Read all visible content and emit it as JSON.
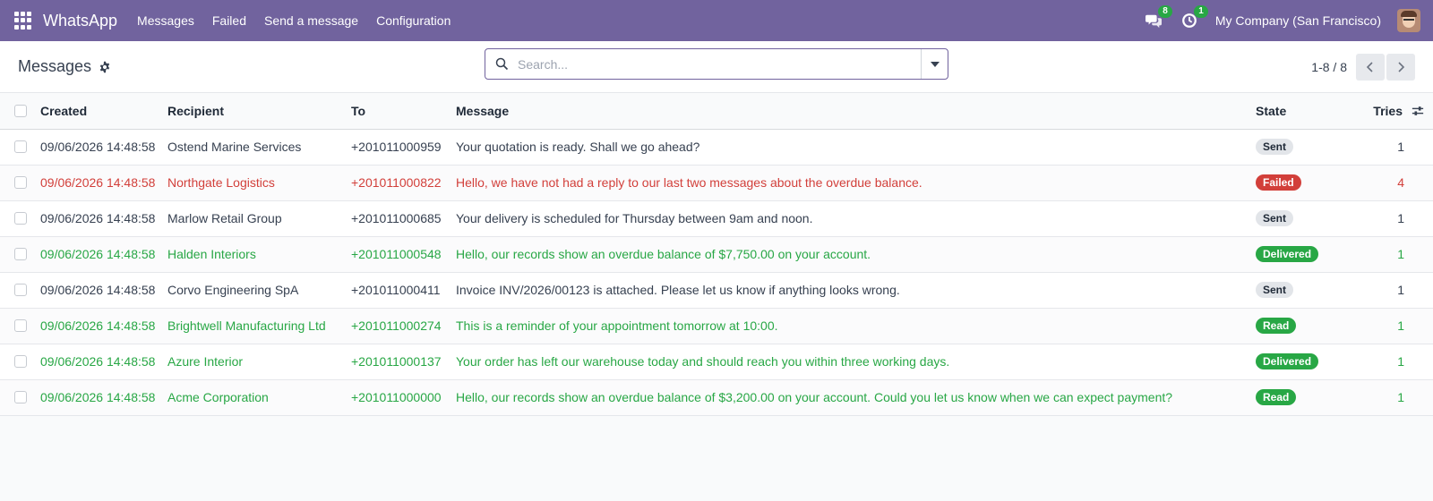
{
  "navbar": {
    "app_name": "WhatsApp",
    "menu": [
      "Messages",
      "Failed",
      "Send a message",
      "Configuration"
    ],
    "messages_count": "8",
    "activities_count": "1",
    "company": "My Company (San Francisco)",
    "color": "#71639e"
  },
  "control_panel": {
    "breadcrumb": "Messages",
    "search_placeholder": "Search...",
    "pager_value": "1-8 / 8"
  },
  "table": {
    "headers": {
      "created": "Created",
      "recipient": "Recipient",
      "to": "To",
      "message": "Message",
      "state": "State",
      "tries": "Tries"
    },
    "rows": [
      {
        "created": "09/06/2026 14:48:58",
        "recipient": "Ostend Marine Services",
        "to": "+201011000959",
        "message": "Your quotation is ready. Shall we go ahead?",
        "state": "Sent",
        "tries": "1",
        "status": "sent"
      },
      {
        "created": "09/06/2026 14:48:58",
        "recipient": "Northgate Logistics",
        "to": "+201011000822",
        "message": "Hello, we have not had a reply to our last two messages about the overdue balance.",
        "state": "Failed",
        "tries": "4",
        "status": "failed"
      },
      {
        "created": "09/06/2026 14:48:58",
        "recipient": "Marlow Retail Group",
        "to": "+201011000685",
        "message": "Your delivery is scheduled for Thursday between 9am and noon.",
        "state": "Sent",
        "tries": "1",
        "status": "sent"
      },
      {
        "created": "09/06/2026 14:48:58",
        "recipient": "Halden Interiors",
        "to": "+201011000548",
        "message": "Hello, our records show an overdue balance of $7,750.00 on your account.",
        "state": "Delivered",
        "tries": "1",
        "status": "delivered"
      },
      {
        "created": "09/06/2026 14:48:58",
        "recipient": "Corvo Engineering SpA",
        "to": "+201011000411",
        "message": "Invoice INV/2026/00123 is attached. Please let us know if anything looks wrong.",
        "state": "Sent",
        "tries": "1",
        "status": "sent"
      },
      {
        "created": "09/06/2026 14:48:58",
        "recipient": "Brightwell Manufacturing Ltd",
        "to": "+201011000274",
        "message": "This is a reminder of your appointment tomorrow at 10:00.",
        "state": "Read",
        "tries": "1",
        "status": "read"
      },
      {
        "created": "09/06/2026 14:48:58",
        "recipient": "Azure Interior",
        "to": "+201011000137",
        "message": "Your order has left our warehouse today and should reach you within three working days.",
        "state": "Delivered",
        "tries": "1",
        "status": "delivered"
      },
      {
        "created": "09/06/2026 14:48:58",
        "recipient": "Acme Corporation",
        "to": "+201011000000",
        "message": "Hello, our records show an overdue balance of $3,200.00 on your account. Could you let us know when we can expect payment?",
        "state": "Read",
        "tries": "1",
        "status": "read"
      }
    ]
  }
}
